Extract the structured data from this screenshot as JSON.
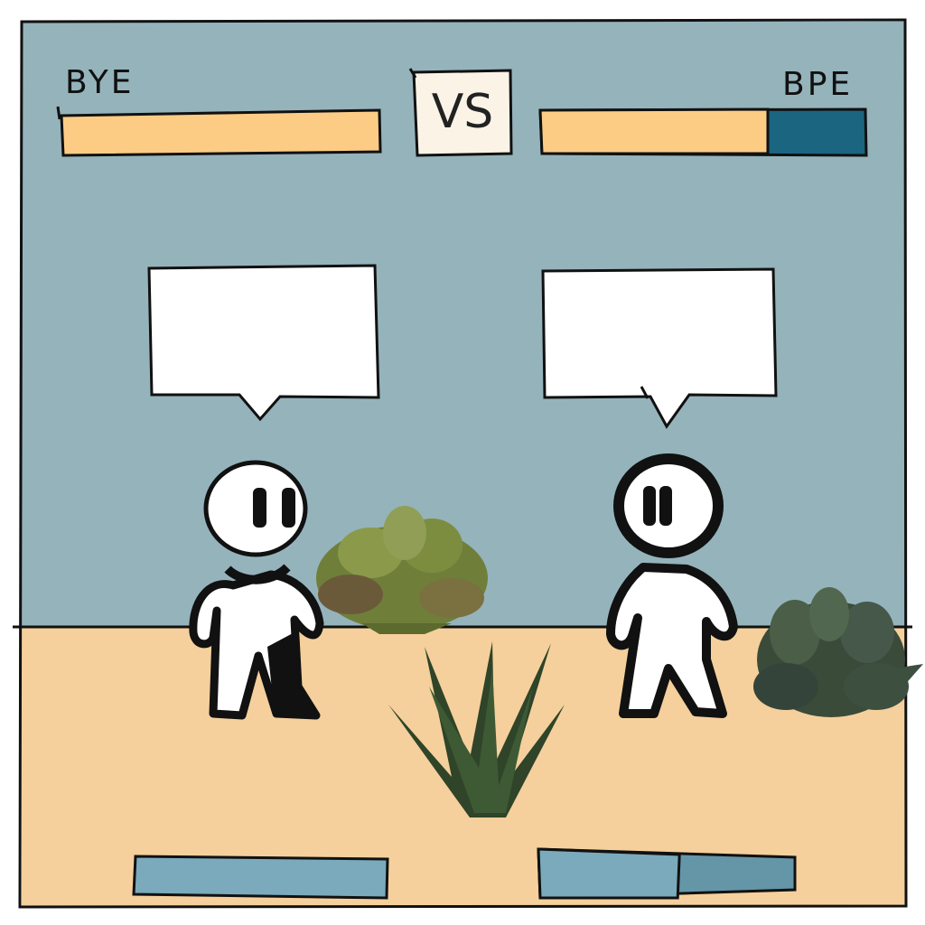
{
  "player_left": {
    "name": "BYE",
    "health_fraction": 1.0
  },
  "player_right": {
    "name": "BPE",
    "health_fraction": 0.7
  },
  "versus_label": "VS",
  "speech_bubbles": {
    "left_text": "",
    "right_text": ""
  },
  "action_bars": {
    "left_fill_fraction": 1.0,
    "right_fill_fraction": 0.55
  },
  "colors": {
    "sky": "#95b3bb",
    "ground": "#f5d09c",
    "health_fill": "#fccc85",
    "health_empty": "#1b6581",
    "vs_box": "#faf3e6",
    "action_bar": "#7aaabc",
    "action_bar_empty": "#6496a8"
  },
  "icons": [
    "stick-figure-left",
    "stick-figure-right",
    "succulent-plant",
    "aloe-plant"
  ]
}
